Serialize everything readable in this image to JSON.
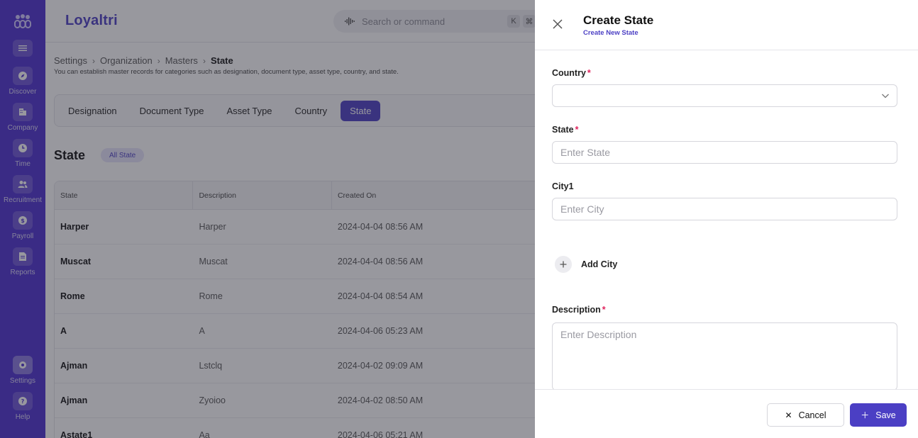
{
  "app": {
    "brand": "Loyaltri",
    "search_placeholder": "Search or command",
    "shortcut_keys": [
      "K",
      "⌘"
    ]
  },
  "sidebar": {
    "items": [
      {
        "label": "Discover",
        "icon": "compass-icon"
      },
      {
        "label": "Company",
        "icon": "building-icon"
      },
      {
        "label": "Time",
        "icon": "clock-icon"
      },
      {
        "label": "Recruitment",
        "icon": "users-icon"
      },
      {
        "label": "Payroll",
        "icon": "dollar-icon"
      },
      {
        "label": "Reports",
        "icon": "document-icon"
      }
    ],
    "bottom_items": [
      {
        "label": "Settings",
        "icon": "gear-icon"
      },
      {
        "label": "Help",
        "icon": "question-icon"
      }
    ]
  },
  "page": {
    "breadcrumb": [
      "Settings",
      "Organization",
      "Masters",
      "State"
    ],
    "subtitle": "You can establish master records for categories such as designation, document type, asset type, country, and state.",
    "tabs": [
      "Designation",
      "Document Type",
      "Asset Type",
      "Country",
      "State"
    ],
    "active_tab": "State",
    "section_title": "State",
    "section_pill": "All State"
  },
  "table": {
    "columns": [
      "State",
      "Description",
      "Created On"
    ],
    "rows": [
      [
        "Harper",
        "Harper",
        "2024-04-04 08:56 AM"
      ],
      [
        "Muscat",
        "Muscat",
        "2024-04-04 08:56 AM"
      ],
      [
        "Rome",
        "Rome",
        "2024-04-04 08:54 AM"
      ],
      [
        "A",
        "A",
        "2024-04-06 05:23 AM"
      ],
      [
        "Ajman",
        "Lstclq",
        "2024-04-02 09:09 AM"
      ],
      [
        "Ajman",
        "Zyoioo",
        "2024-04-02 08:50 AM"
      ],
      [
        "Astate1",
        "Aa",
        "2024-04-06 05:21 AM"
      ]
    ]
  },
  "drawer": {
    "title": "Create State",
    "subtitle": "Create New State",
    "country_label": "Country",
    "country_value": "",
    "state_label": "State",
    "state_placeholder": "Enter State",
    "city_label": "City1",
    "city_placeholder": "Enter City",
    "add_city_label": "Add City",
    "description_label": "Description",
    "description_placeholder": "Enter Description",
    "required_mark": "*",
    "cancel_label": "Cancel",
    "save_label": "Save"
  },
  "colors": {
    "accent": "#4b3fc4",
    "sidebar": "#4b2fcf",
    "required": "#e0245e"
  }
}
